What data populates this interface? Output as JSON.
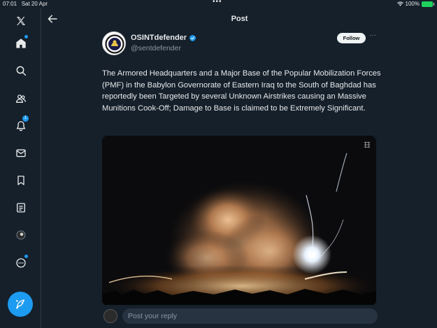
{
  "status_bar": {
    "time": "07:01",
    "date": "Sat 20 Apr",
    "battery": "100%",
    "colors": {
      "battery": "#1fd15c"
    }
  },
  "sidebar": {
    "items": [
      {
        "icon": "x-logo-icon"
      },
      {
        "icon": "home-icon"
      },
      {
        "icon": "search-icon"
      },
      {
        "icon": "communities-icon"
      },
      {
        "icon": "notifications-icon",
        "badge": "1"
      },
      {
        "icon": "messages-icon"
      },
      {
        "icon": "bookmarks-icon"
      },
      {
        "icon": "lists-icon"
      },
      {
        "icon": "profile-avatar-icon"
      },
      {
        "icon": "more-icon"
      }
    ],
    "compose_icon": "compose-feather-icon"
  },
  "header": {
    "title": "Post"
  },
  "post": {
    "author": {
      "name": "OSINTdefender",
      "handle": "@sentdefender",
      "verified": true
    },
    "follow_label": "Follow",
    "text": "The Armored Headquarters and a Major Base of the Popular Mobilization Forces (PMF) in the Babylon Governorate of Eastern Iraq to the South of Baghdad has reportedly been Targeted by several Unknown Airstrikes causing an Massive Munitions Cook-Off; Damage to Base is claimed to be Extremely Significant.",
    "media_type": "video"
  },
  "reply": {
    "placeholder": "Post your reply"
  },
  "colors": {
    "accent": "#1d9bf0",
    "background": "#15202b",
    "muted": "#8b98a5",
    "input_bg": "#273340"
  }
}
